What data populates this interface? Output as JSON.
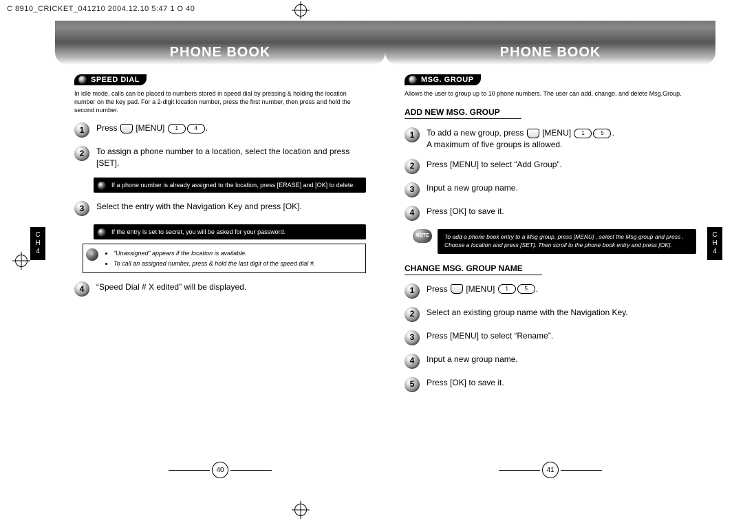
{
  "meta": {
    "header": "C    8910_CRICKET_041210  2004.12.10 5:47     1   O 40"
  },
  "left": {
    "banner": "PHONE BOOK",
    "section": "SPEED DIAL",
    "intro": "In idle mode, calls can be placed to numbers stored in speed dial by pressing & holding the location number on the key pad. For a 2-digit location number, press the first number, then press and hold the second number.",
    "steps": {
      "s1": "Press        [MENU]            .",
      "s2": "To assign a phone number to a location, select the location and press     [SET].",
      "note1": "If a phone number is already assigned to the location, press      [ERASE] and      [OK] to delete.",
      "s3": "Select the entry with the Navigation Key and press     [OK].",
      "note2": "If the entry is set to secret, you will be asked for your password.",
      "tips1": "“Unassigned” appears if the location is available.",
      "tips2": "To call an assigned number, press & hold the last digit of the speed dial #.",
      "s4": "“Speed Dial # X edited” will be displayed."
    },
    "ch": "C\nH\n4",
    "page": "40"
  },
  "right": {
    "banner": "PHONE BOOK",
    "section": "MSG. GROUP",
    "intro": "Allows the user to group up to 10 phone numbers. The user can add, change, and delete Msg.Group.",
    "sub1": "ADD NEW MSG. GROUP",
    "add": {
      "s1a": "To add a new group, press        [MENU]            .",
      "s1b": "A maximum of five groups is allowed.",
      "s2": "Press        [MENU] to select “Add Group”.",
      "s3": "Input a new group name.",
      "s4": "Press     [OK] to save it."
    },
    "note": "To add a phone book entry to a Msg group, press        [MENU]               , select the Msg group and press       . Choose a location and press      [SET]. Then scroll to the phone book entry and press      [OK].",
    "sub2": "CHANGE MSG. GROUP NAME",
    "chg": {
      "s1": "Press        [MENU]            .",
      "s2": "Select an existing group name with the Navigation Key.",
      "s3": "Press        [MENU] to select “Rename”.",
      "s4": "Input a new group name.",
      "s5": "Press     [OK] to save it."
    },
    "ch": "C\nH\n4",
    "page": "41"
  }
}
